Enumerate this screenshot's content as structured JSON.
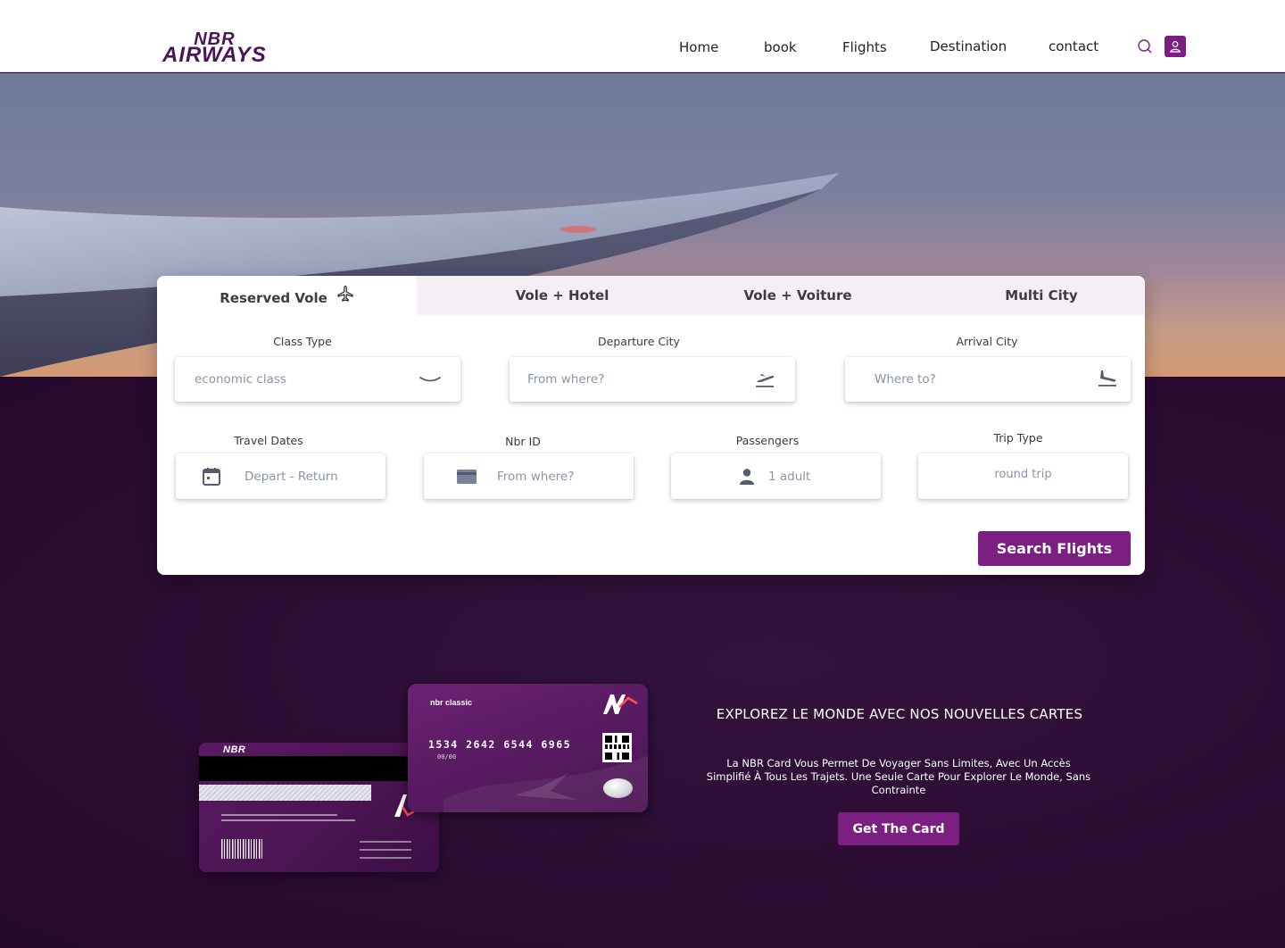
{
  "brand": {
    "line1": "NBR",
    "line2": "AIRWAYS"
  },
  "nav": {
    "items": [
      "Home",
      "book",
      "Flights",
      "Destination",
      "contact"
    ]
  },
  "icons": {
    "search": "search-icon",
    "user": "user-icon"
  },
  "colors": {
    "accent": "#7b1f82",
    "dark_bg": "#2b0c33",
    "brand_text": "#4a1457"
  },
  "booking": {
    "tabs": [
      "Reserved Vole",
      "Vole + Hotel",
      "Vole + Voiture",
      "Multi City"
    ],
    "class_type": {
      "label": "Class Type",
      "value": "economic class"
    },
    "departure": {
      "label": "Departure City",
      "placeholder": "From where?"
    },
    "arrival": {
      "label": "Arrival City",
      "placeholder": "Where to?"
    },
    "dates": {
      "label": "Travel Dates",
      "value": "Depart - Return"
    },
    "nbr_id": {
      "label": "Nbr ID",
      "placeholder": "From where?"
    },
    "passengers": {
      "label": "Passengers",
      "value": "1 adult"
    },
    "trip_type": {
      "label": "Trip Type",
      "value": "round trip"
    },
    "search_label": "Search Flights"
  },
  "cards": {
    "back_brand": "NBR",
    "front_name": "nbr classic",
    "front_number": "1534 2642 6544 6965",
    "front_expiry": "00/00"
  },
  "promo": {
    "title": "EXPLOREZ LE MONDE AVEC NOS NOUVELLES CARTES",
    "text": "La NBR Card Vous Permet De Voyager Sans Limites, Avec Un Accès Simplifié À Tous Les Trajets. Une Seule Carte Pour Explorer Le Monde, Sans Contrainte",
    "button": "Get The Card"
  }
}
